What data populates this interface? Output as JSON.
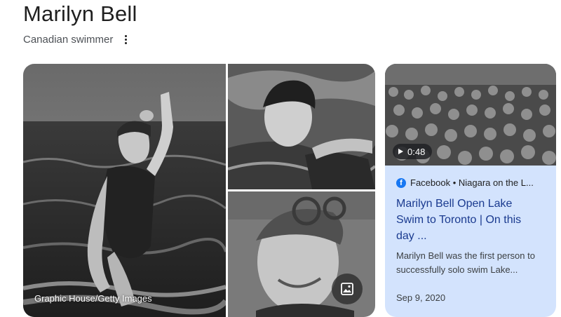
{
  "entity": {
    "name": "Marilyn Bell",
    "description": "Canadian swimmer",
    "more_icon": "more-vert-icon"
  },
  "gallery": {
    "credit": "Graphic House/Getty Images",
    "images_button_icon": "image-icon"
  },
  "video_card": {
    "duration": "0:48",
    "play_icon": "play-icon",
    "source_icon": "facebook-icon",
    "source": "Facebook • Niagara on the L...",
    "title": "Marilyn Bell Open Lake Swim to Toronto | On this day ...",
    "description": "Marilyn Bell was the first person to successfully solo swim Lake...",
    "date": "Sep 9, 2020"
  },
  "colors": {
    "card_background": "#d3e3fd",
    "title_link": "#1a3a8f",
    "facebook_blue": "#1877f2"
  }
}
